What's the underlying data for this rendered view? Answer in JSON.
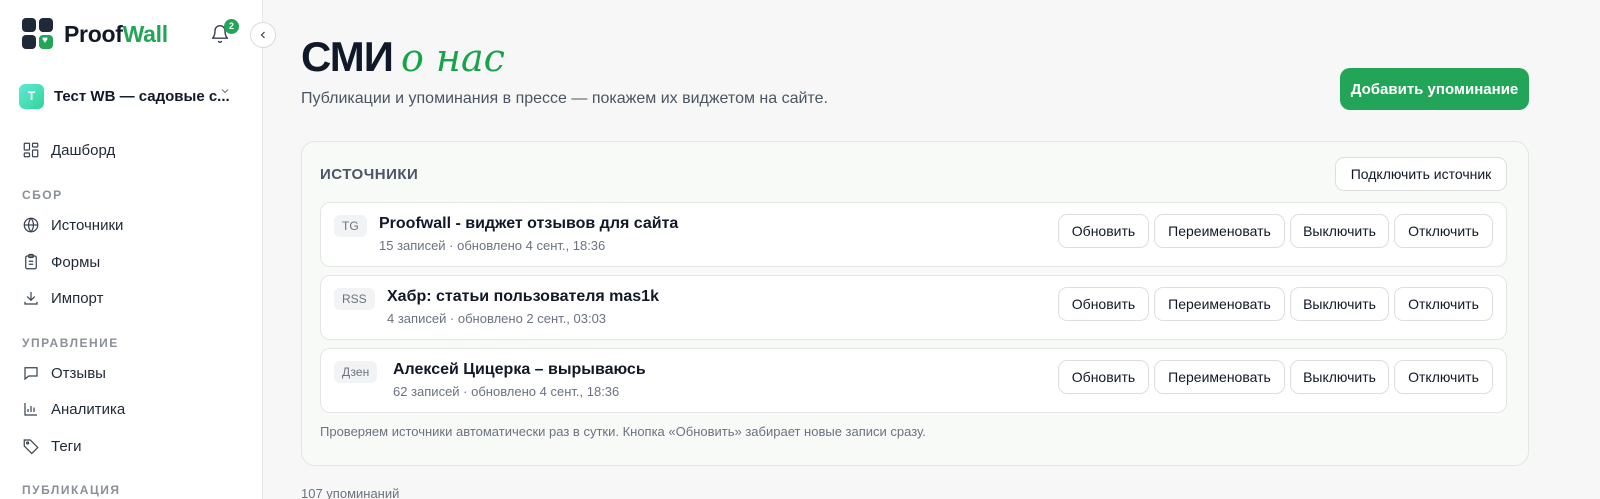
{
  "brand": {
    "name_part1": "Proof",
    "name_part2": "Wall",
    "accent": "#22a559"
  },
  "header": {
    "notification_count": "2"
  },
  "workspace": {
    "avatar_letter": "T",
    "name": "Тест WB — садовые с..."
  },
  "sidebar": {
    "dashboard": "Дашборд",
    "section_collect": "СБОР",
    "sources": "Источники",
    "forms": "Формы",
    "import": "Импорт",
    "section_manage": "УПРАВЛЕНИЕ",
    "reviews": "Отзывы",
    "analytics": "Аналитика",
    "tags": "Теги",
    "section_publish": "ПУБЛИКАЦИЯ"
  },
  "page": {
    "title": "СМИ",
    "title_accent": "о нас",
    "subtitle": "Публикации и упоминания в прессе — покажем их виджетом на сайте.",
    "add_button": "Добавить упоминание"
  },
  "panel": {
    "title": "ИСТОЧНИКИ",
    "connect_button": "Подключить источник",
    "note": "Проверяем источники автоматически раз в сутки. Кнопка «Обновить» забирает новые записи сразу.",
    "sources": [
      {
        "tag": "TG",
        "name": "Proofwall - виджет отзывов для сайта",
        "meta": "15 записей · обновлено 4 сент., 18:36"
      },
      {
        "tag": "RSS",
        "name": "Хабр: статьи пользователя mas1k",
        "meta": "4 записей · обновлено 2 сент., 03:03"
      },
      {
        "tag": "Дзен",
        "name": "Алексей Цицерка – вырываюсь",
        "meta": "62 записей · обновлено 4 сент., 18:36"
      }
    ],
    "actions": {
      "refresh": "Обновить",
      "rename": "Переименовать",
      "disable": "Выключить",
      "disconnect": "Отключить"
    }
  },
  "footer": {
    "count_text": "107 упоминаний"
  }
}
